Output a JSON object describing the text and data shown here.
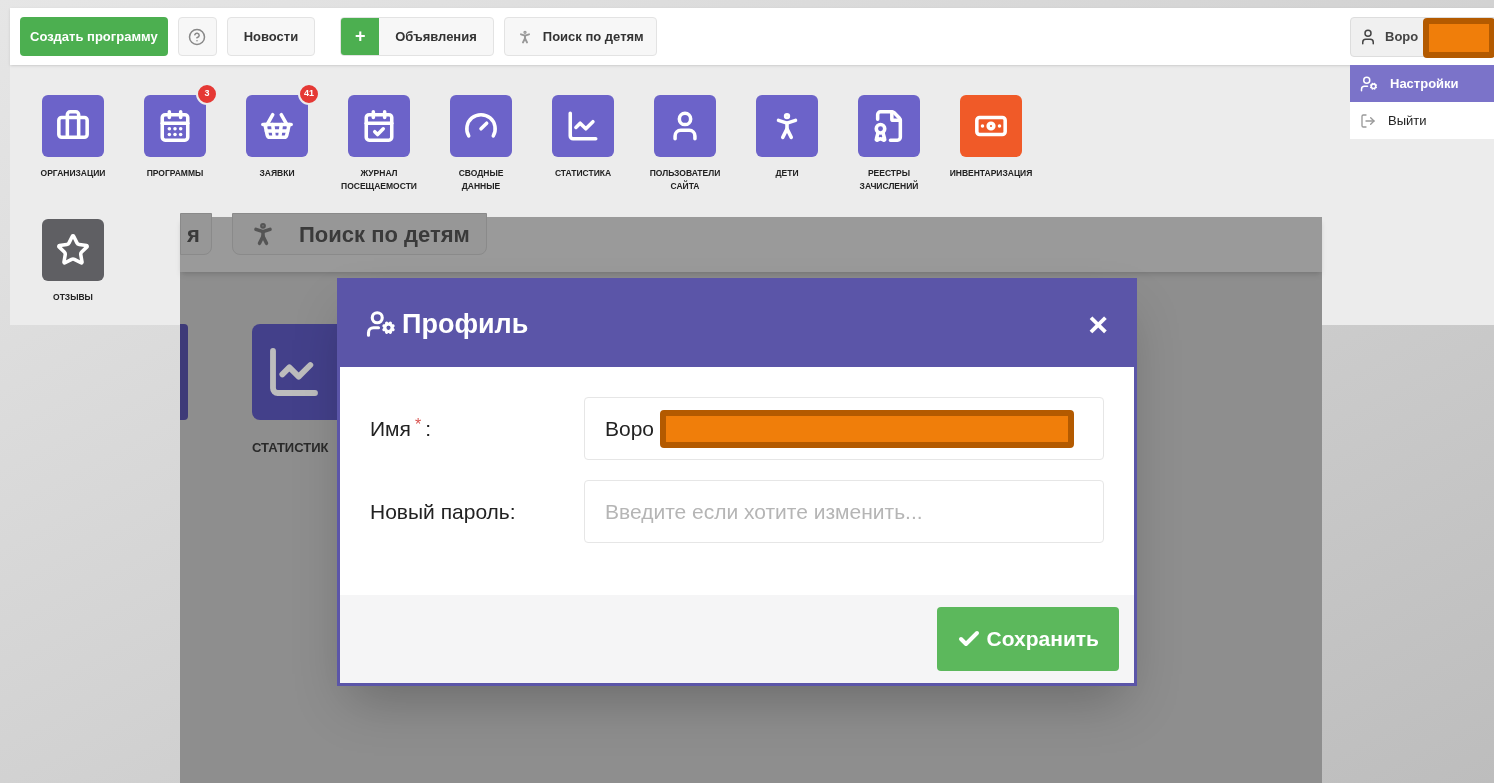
{
  "top_screenshot": {
    "toolbar": {
      "create_button": "Создать программу",
      "news_button": "Новости",
      "ads_button": {
        "plus": "+",
        "label": "Объявления"
      },
      "children_search_button": "Поиск по детям",
      "user_button": {
        "label": "Воро",
        "redacted": true
      }
    },
    "user_menu": [
      {
        "label": "Настройки",
        "selected": true,
        "kind": "settings"
      },
      {
        "label": "Выйти",
        "selected": false,
        "kind": "logout"
      }
    ],
    "tiles": [
      {
        "label": "ОРГАНИЗАЦИИ",
        "kind": "briefcase",
        "color": "#6c63c9"
      },
      {
        "label": "ПРОГРАММЫ",
        "kind": "calendar",
        "color": "#6c63c9",
        "badge": "3"
      },
      {
        "label": "ЗАЯВКИ",
        "kind": "basket",
        "color": "#6c63c9",
        "badge": "41"
      },
      {
        "label": "ЖУРНАЛ\nПОСЕЩАЕМОСТИ",
        "kind": "calendar-check",
        "color": "#6c63c9"
      },
      {
        "label": "СВОДНЫЕ\nДАННЫЕ",
        "kind": "gauge",
        "color": "#6c63c9"
      },
      {
        "label": "СТАТИСТИКА",
        "kind": "chart",
        "color": "#6c63c9"
      },
      {
        "label": "ПОЛЬЗОВАТЕЛИ\nСАЙТА",
        "kind": "user",
        "color": "#6c63c9"
      },
      {
        "label": "ДЕТИ",
        "kind": "child",
        "color": "#6c63c9"
      },
      {
        "label": "РЕЕСТРЫ\nЗАЧИСЛЕНИЙ",
        "kind": "document",
        "color": "#6c63c9"
      },
      {
        "label": "ИНВЕНТАРИЗАЦИЯ",
        "kind": "banknote",
        "color": "#f05a28"
      },
      {
        "label": "ОТЗЫВЫ",
        "kind": "star",
        "color": "#5f5f63"
      }
    ]
  },
  "zoomed_screenshot": {
    "toolbar": {
      "partial_button": "я",
      "children_search_button": "Поиск по детям"
    },
    "tiles": [
      {
        "label": "СТАТИСТИК",
        "kind": "chart"
      }
    ],
    "profile_dialog": {
      "title": "Профиль",
      "close": "×",
      "fields": [
        {
          "label": "Имя",
          "required_mark": "*",
          "suffix": ":",
          "value": "Воро",
          "redacted": true
        },
        {
          "label": "Новый пароль:",
          "placeholder": "Введите если хотите изменить..."
        }
      ],
      "save_button": "Сохранить"
    }
  }
}
